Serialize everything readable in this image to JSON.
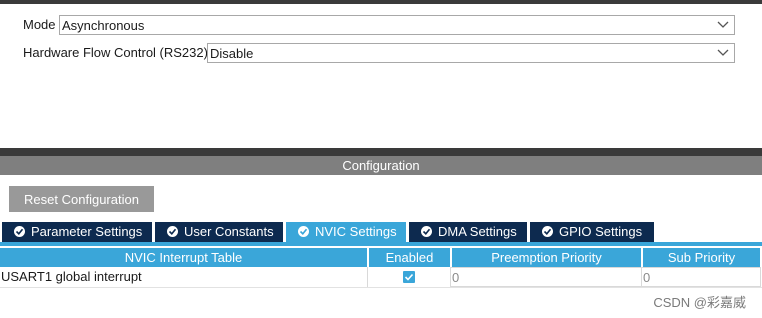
{
  "mode": {
    "label": "Mode",
    "value": "Asynchronous"
  },
  "flow_control": {
    "label": "Hardware Flow Control (RS232)",
    "value": "Disable"
  },
  "config_header": "Configuration",
  "reset_button": "Reset Configuration",
  "tabs": [
    {
      "label": "Parameter Settings",
      "active": false
    },
    {
      "label": "User Constants",
      "active": false
    },
    {
      "label": "NVIC Settings",
      "active": true
    },
    {
      "label": "DMA Settings",
      "active": false
    },
    {
      "label": "GPIO Settings",
      "active": false
    }
  ],
  "table": {
    "headers": [
      "NVIC Interrupt Table",
      "Enabled",
      "Preemption Priority",
      "Sub Priority"
    ],
    "rows": [
      {
        "name": "USART1 global interrupt",
        "enabled": true,
        "preemption": "0",
        "sub": "0"
      }
    ]
  },
  "watermark": "CSDN @彩嘉威",
  "colors": {
    "tab_dark": "#0d2a4f",
    "accent": "#3aa6d9",
    "bar_gray": "#7f7f7f",
    "button_gray": "#999999"
  }
}
